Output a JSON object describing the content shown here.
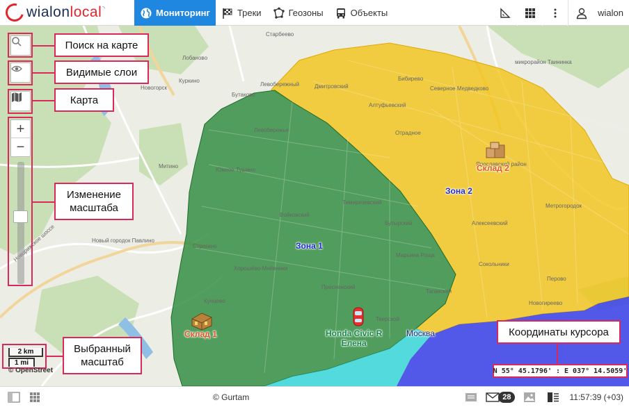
{
  "app": {
    "logo_text_1": "wialon",
    "logo_text_2": "local"
  },
  "nav": [
    {
      "label": "Мониторинг",
      "icon": "globe-icon",
      "active": true
    },
    {
      "label": "Треки",
      "icon": "checkered-flag-icon"
    },
    {
      "label": "Геозоны",
      "icon": "geozone-icon"
    },
    {
      "label": "Объекты",
      "icon": "bus-icon"
    }
  ],
  "user": {
    "name": "wialon"
  },
  "callouts": {
    "search": "Поиск на карте",
    "layers": "Видимые слои",
    "map": "Карта",
    "zoom_line1": "Изменение",
    "zoom_line2": "масштаба",
    "scale_line1": "Выбранный",
    "scale_line2": "масштаб",
    "coords": "Координаты курсора"
  },
  "map": {
    "zones": [
      {
        "name": "Зона 1",
        "color": "#2e8b3e"
      },
      {
        "name": "Зона 2",
        "color": "#f2c318"
      }
    ],
    "warehouses": [
      "Склад 1",
      "Склад 2"
    ],
    "unit": {
      "name_line1": "Honda Civic R",
      "name_line2": "Елена"
    },
    "city_label": "Москва",
    "scale_km": "2 km",
    "scale_mi": "1 mi",
    "attribution": "© OpenStreet",
    "cursor_coords": "N 55° 45.1796' : E 037° 14.5059'",
    "street_labels": [
      "Старбеево",
      "Лобаново",
      "Куркино",
      "Новогорск",
      "Бутаково",
      "Левобережный",
      "Дмитровский",
      "Бибирево",
      "Северное Медведково",
      "микрорайон Таининка",
      "Алтуфьевский",
      "Отрадное",
      "Ярославский район",
      "Левобережье",
      "Южное Тушино",
      "Митино",
      "Тимирязевский",
      "Бутырский",
      "Алексеевский",
      "Метрогородок",
      "Войковский",
      "Строгино",
      "Хорошёво-Мнёвники",
      "Сокольники",
      "Пресненский",
      "Таганский",
      "Перово",
      "Кунцево",
      "Марьина Роща",
      "Тверской",
      "Новогиреево",
      "Новорижское шоссе",
      "Новый городок Павлино"
    ]
  },
  "footer": {
    "copyright": "© Gurtam",
    "messages_count": "28",
    "time": "11:57:39 (+03)"
  },
  "colors": {
    "accent": "#1f87e0",
    "callout_border": "#d9285a",
    "zone1": "#2e8b3e",
    "zone2": "#f2c318",
    "zone_cyan": "#37d6dc",
    "zone_blue": "#3c43e8"
  }
}
